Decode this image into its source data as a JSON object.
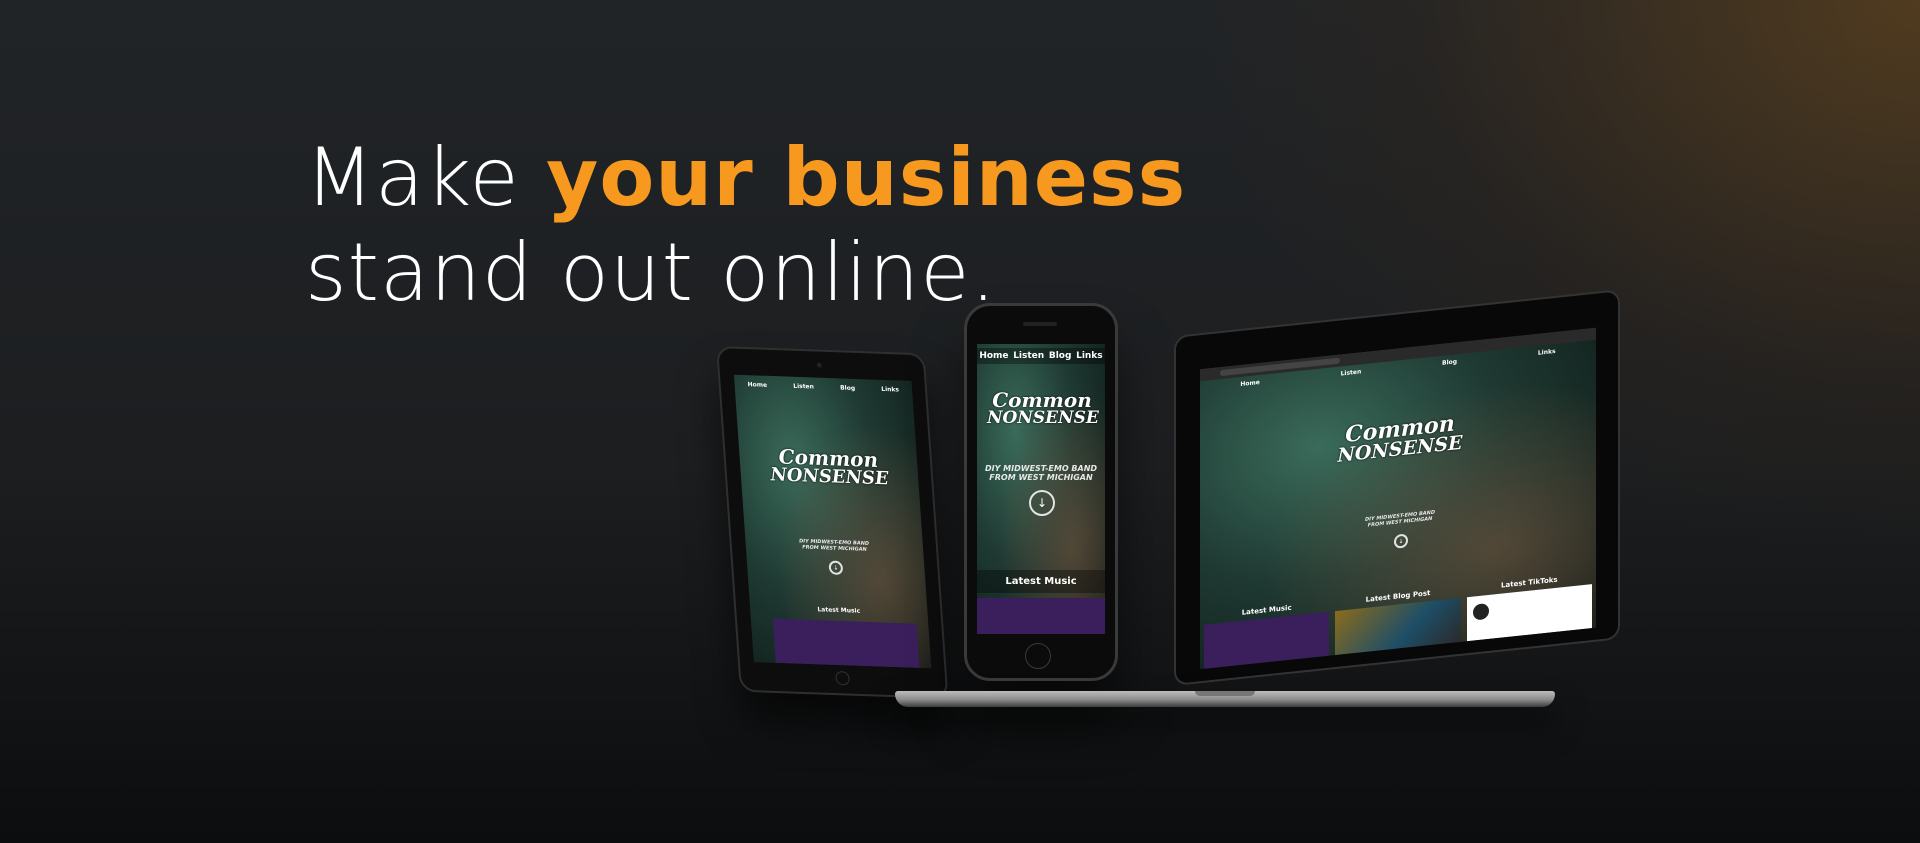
{
  "hero": {
    "line1_prefix": "Make ",
    "line1_accent": "your business",
    "line2": "stand out online."
  },
  "site": {
    "nav": [
      "Home",
      "Listen",
      "Blog",
      "Links"
    ],
    "logo_line1": "Common",
    "logo_line2": "NONSENSE",
    "tagline_line1": "DIY MIDWEST-EMO BAND",
    "tagline_line2": "FROM WEST MICHIGAN",
    "latest_music": "Latest Music",
    "latest_blog_post": "Latest Blog Post",
    "latest_tiktoks": "Latest TikToks"
  },
  "colors": {
    "accent": "#f7991f",
    "purple": "#3b1f5c"
  },
  "icons": {
    "down": "down-arrow-circle-icon"
  }
}
